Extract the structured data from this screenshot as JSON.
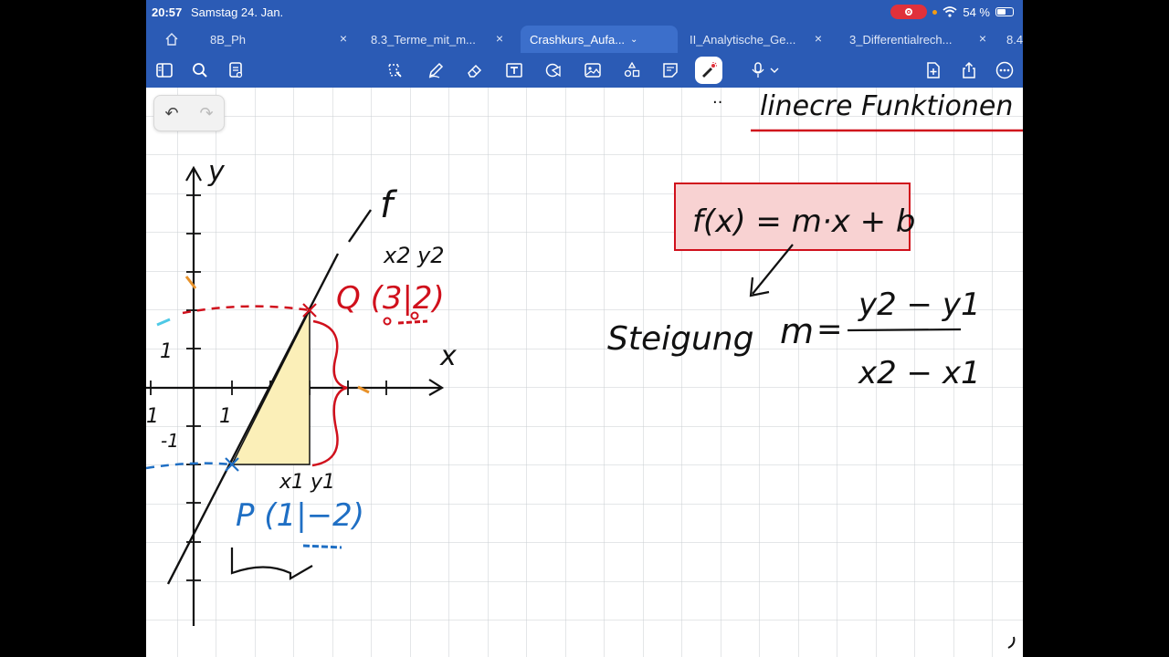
{
  "status": {
    "time": "20:57",
    "date": "Samstag 24. Jan.",
    "battery": "54 %",
    "battery_level": 0.54
  },
  "tabs": [
    {
      "label": "8B_Ph",
      "active": false
    },
    {
      "label": "8.3_Terme_mit_m...",
      "active": false
    },
    {
      "label": "Crashkurs_Aufa...",
      "active": true
    },
    {
      "label": "II_Analytische_Ge...",
      "active": false
    },
    {
      "label": "3_Differentialrech...",
      "active": false
    },
    {
      "label": "8.4",
      "active": false
    }
  ],
  "toolbar": {
    "left_icons": [
      "sidebar-icon",
      "search-icon",
      "page-list-icon"
    ],
    "center_icons": [
      "lasso-icon",
      "pen-icon",
      "eraser-icon",
      "text-box-icon",
      "shapes-icon",
      "image-icon",
      "stickers-icon",
      "sticky-note-icon",
      "laser-pointer-icon",
      "microphone-icon"
    ],
    "right_icons": [
      "add-page-icon",
      "share-icon",
      "more-icon"
    ]
  },
  "colors": {
    "accent": "#2b5bb5",
    "red": "#d0101c",
    "blue": "#1f6fc4",
    "grid": "#c9cdd2",
    "fill": "#fbefb8",
    "orange": "#e8922a",
    "cyan": "#4ec9e6"
  },
  "notes": {
    "heading": "linecre Funktionen",
    "function": "f(x) = m·x + b",
    "slope_label": "Steigung",
    "slope_var": "m",
    "slope_num": "y2 − y1",
    "slope_den": "x2 − x1",
    "point_q": "Q (3|2)",
    "q_label": "x2 y2",
    "point_p": "P (1|−2)",
    "p_label": "x1 y1",
    "graph_label": "f",
    "axis_x": "x",
    "axis_y": "y",
    "tick_1": "1",
    "tick_neg1": "-1"
  }
}
